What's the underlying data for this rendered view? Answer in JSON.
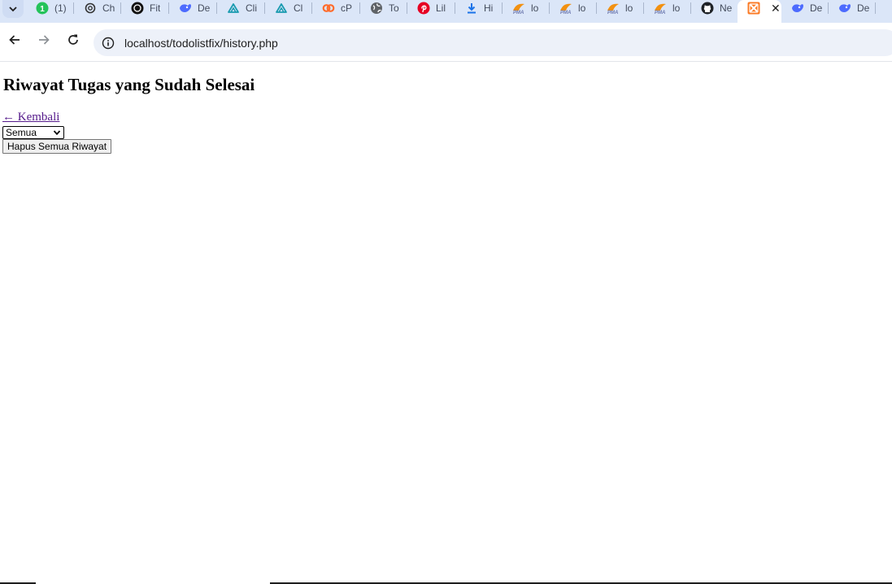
{
  "tabs": [
    {
      "label": "(1)",
      "icon": "whatsapp-badge-icon"
    },
    {
      "label": "Ch",
      "icon": "openai-icon"
    },
    {
      "label": "Fit",
      "icon": "openai-dark-icon"
    },
    {
      "label": "De",
      "icon": "deepseek-icon"
    },
    {
      "label": "Cli",
      "icon": "claude-icon"
    },
    {
      "label": "Cl",
      "icon": "claude-icon"
    },
    {
      "label": "cP",
      "icon": "cpanel-icon"
    },
    {
      "label": "To",
      "icon": "globe-icon"
    },
    {
      "label": "Lil",
      "icon": "pinterest-icon"
    },
    {
      "label": "Hi",
      "icon": "download-icon"
    },
    {
      "label": "lo",
      "icon": "phpmyadmin-icon"
    },
    {
      "label": "lo",
      "icon": "phpmyadmin-icon"
    },
    {
      "label": "lo",
      "icon": "phpmyadmin-icon"
    },
    {
      "label": "lo",
      "icon": "phpmyadmin-icon"
    },
    {
      "label": "Ne",
      "icon": "github-icon"
    },
    {
      "label": "",
      "icon": "xampp-icon",
      "active": true
    },
    {
      "label": "De",
      "icon": "deepseek-icon"
    },
    {
      "label": "De",
      "icon": "deepseek-icon"
    }
  ],
  "toolbar": {
    "url": "localhost/todolistfix/history.php"
  },
  "page": {
    "title": "Riwayat Tugas yang Sudah Selesai",
    "back_link": "← Kembali",
    "filter_selected": "Semua",
    "clear_button": "Hapus Semua Riwayat"
  },
  "colors": {
    "tabstrip_bg": "#dbe6f8",
    "omnibox_bg": "#edf1f9",
    "visited_link": "#551a8b"
  }
}
